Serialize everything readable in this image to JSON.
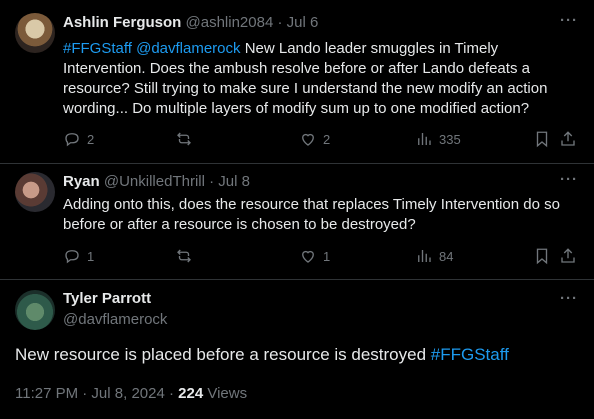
{
  "replies": [
    {
      "name": "Ashlin Ferguson",
      "handle": "@ashlin2084",
      "sep": "·",
      "date": "Jul 6",
      "text_tag1": "#FFGStaff",
      "text_mention": "@davflamerock",
      "text_line1_rest": " New Lando leader smuggles in Timely",
      "text_line2": "Intervention. Does the ambush resolve before or after Lando defeats a",
      "text_line3": "resource? Still trying to make sure I understand the new modify an action",
      "text_line4": "wording... Do multiple layers of modify sum up to one modified action?",
      "replies_count": "2",
      "reposts_count": "",
      "likes_count": "2",
      "views_count": "335"
    },
    {
      "name": "Ryan",
      "handle": "@UnkilledThrill",
      "sep": "·",
      "date": "Jul 8",
      "text_line1": "Adding onto this, does the resource that replaces Timely Intervention do so",
      "text_line2": "before or after a resource is chosen to be destroyed?",
      "replies_count": "1",
      "reposts_count": "",
      "likes_count": "1",
      "views_count": "84"
    }
  ],
  "main": {
    "name": "Tyler Parrott",
    "handle": "@davflamerock",
    "text": "New resource is placed before a resource is destroyed ",
    "tag": "#FFGStaff",
    "time": "11:27 PM · Jul 8, 2024 · ",
    "views_count": "224",
    "views_label": " Views"
  },
  "more_label": "···",
  "colors": {
    "accent": "#1d9bf0",
    "muted": "#71767b",
    "text": "#e7e9ea",
    "background": "#000000"
  }
}
